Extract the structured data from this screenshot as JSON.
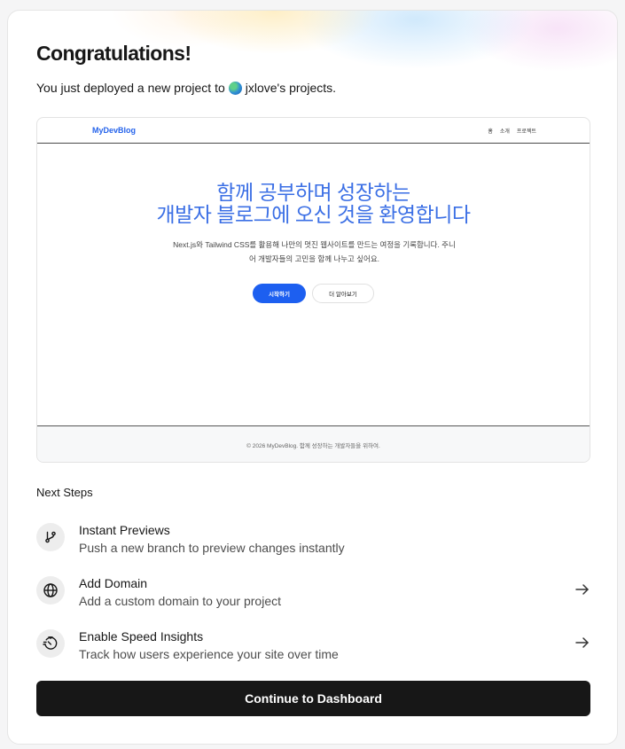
{
  "header": {
    "title": "Congratulations!",
    "subtitle_prefix": "You just deployed a new project to",
    "team_name": "jxlove's projects."
  },
  "preview": {
    "nav": {
      "logo": "MyDevBlog",
      "links": [
        "홈",
        "소개",
        "프로젝트"
      ]
    },
    "hero": {
      "title_line1": "함께 공부하며 성장하는",
      "title_line2": "개발자 블로그에 오신 것을 환영합니다",
      "description": "Next.js와 Tailwind CSS를 활용해 나만의 멋진 웹사이트를 만드는 여정을 기록합니다. 주니어 개발자들의 고민을 함께 나누고 싶어요.",
      "primary_button": "시작하기",
      "secondary_button": "더 알아보기"
    },
    "footer": "© 2026 MyDevBlog. 함께 성장하는 개발자들을 위하여."
  },
  "next_steps": {
    "heading": "Next Steps",
    "items": [
      {
        "icon": "git-branch-icon",
        "title": "Instant Previews",
        "description": "Push a new branch to preview changes instantly",
        "has_arrow": false
      },
      {
        "icon": "globe-icon",
        "title": "Add Domain",
        "description": "Add a custom domain to your project",
        "has_arrow": true
      },
      {
        "icon": "speed-insights-icon",
        "title": "Enable Speed Insights",
        "description": "Track how users experience your site over time",
        "has_arrow": true
      }
    ]
  },
  "continue_button": "Continue to Dashboard",
  "colors": {
    "accent_blue": "#2563eb",
    "button_dark": "#171717"
  }
}
